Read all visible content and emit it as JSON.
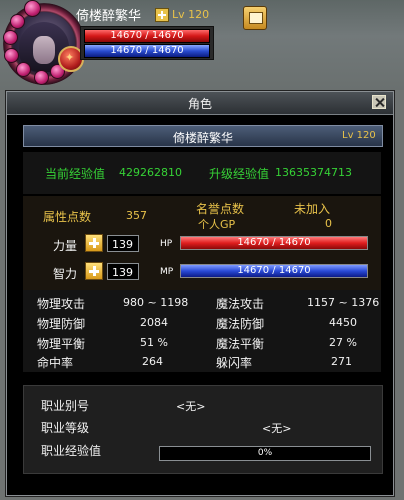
{
  "hud": {
    "character_name": "倚楼醉繁华",
    "level": "Lv 120",
    "hp_text": "14670 / 14670",
    "mp_text": "14670 / 14670",
    "badge_glyph": "✦",
    "hp_fraction": 1.0,
    "mp_fraction": 1.0
  },
  "panel": {
    "title": "角色",
    "name": "倚楼醉繁华",
    "level": "Lv 120",
    "exp": {
      "current_label": "当前经验值",
      "current_value": "429262810",
      "next_label": "升级经验值",
      "next_value": "13635374713"
    },
    "attributes": {
      "points_label": "属性点数",
      "points_value": "357",
      "reputation_label": "名誉点数",
      "reputation_value": "未加入",
      "gp_label": "个人GP",
      "gp_value": "0",
      "strength_label": "力量",
      "strength_value": "139",
      "hp_label": "HP",
      "hp_text": "14670 / 14670",
      "intellect_label": "智力",
      "intellect_value": "139",
      "mp_label": "MP",
      "mp_text": "14670 / 14670"
    },
    "stats": {
      "phys_atk_label": "物理攻击",
      "phys_atk_value": "980 ~ 1198",
      "mag_atk_label": "魔法攻击",
      "mag_atk_value": "1157 ~ 1376",
      "phys_def_label": "物理防御",
      "phys_def_value": "2084",
      "mag_def_label": "魔法防御",
      "mag_def_value": "4450",
      "phys_bal_label": "物理平衡",
      "phys_bal_value": "51 %",
      "mag_bal_label": "魔法平衡",
      "mag_bal_value": "27 %",
      "hit_label": "命中率",
      "hit_value": "264",
      "dodge_label": "躲闪率",
      "dodge_value": "271"
    },
    "job": {
      "alias_label": "职业别号",
      "alias_value": "<无>",
      "level_label": "职业等级",
      "level_value": "<无>",
      "exp_label": "职业经验值",
      "exp_text": "0%",
      "exp_fraction": 0
    }
  },
  "colors": {
    "hp": "#e01e1e",
    "mp": "#2a4ad6",
    "label_green": "#36d236",
    "label_yellow": "#e8c24a",
    "panel_bg": "#000000"
  },
  "icons": [
    "portrait",
    "plus-icon",
    "quest-scroll-icon",
    "close-icon"
  ]
}
